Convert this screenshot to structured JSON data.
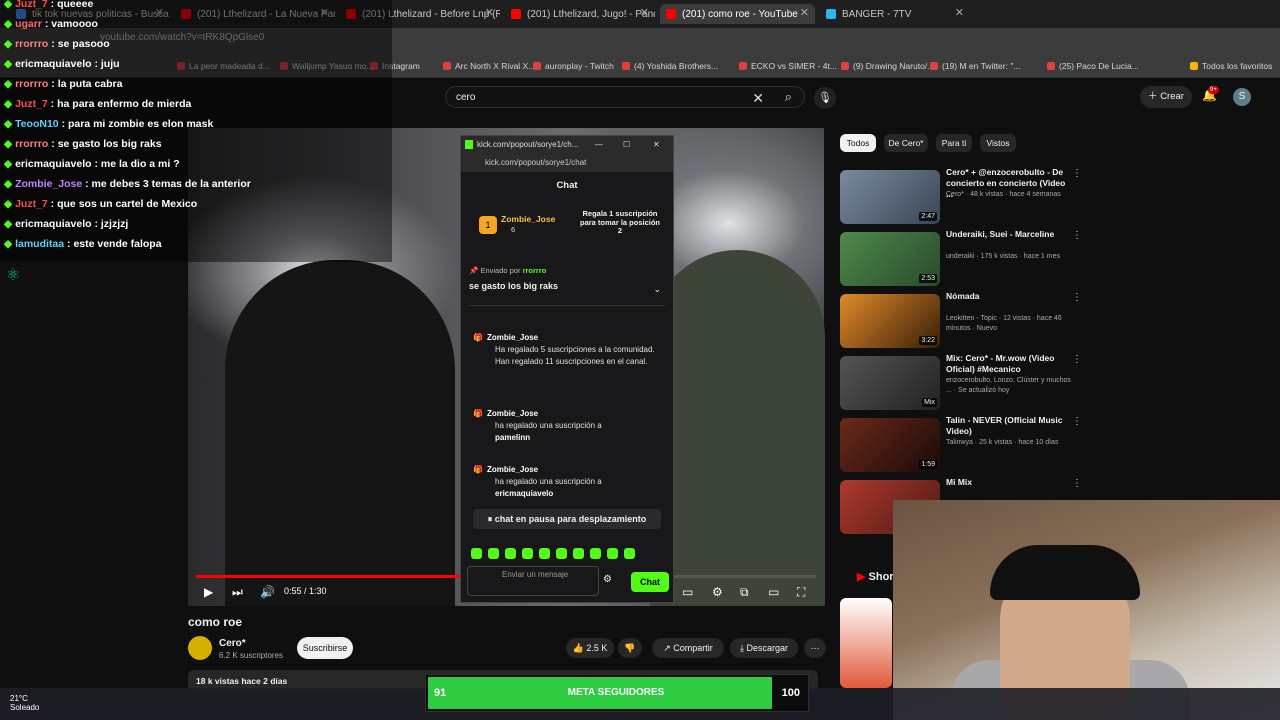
{
  "tabs": [
    {
      "label": "tik tok nuevas politicas - Busca",
      "color": "#4285f4"
    },
    {
      "label": "(201) Lthelizard - La Nueva Pan",
      "color": "#ff0000"
    },
    {
      "label": "(201) Lthelizard - Before Lnp (R",
      "color": "#ff0000"
    },
    {
      "label": "(201) Lthelizard, Jugo! - Pandem",
      "color": "#ff0000"
    },
    {
      "label": "(201) como roe - YouTube",
      "color": "#ff0000"
    },
    {
      "label": "BANGER - 7TV",
      "color": "#29b6f6"
    }
  ],
  "url": "youtube.com/watch?v=tRK8QpGlse0",
  "bookmarks": [
    "Arc North X Rival X...",
    "auronplay - Twitch",
    "(4) Yoshida Brothers...",
    "ECKO vs SIMER - 4t...",
    "(9) Drawing Naruto/...",
    "(19) M en Twitter: \"...",
    "(25) Paco De Lucia...",
    "Todos los favoritos",
    "Instagram",
    "La peor madeada d...",
    "Walljump Yasuo mo..."
  ],
  "yt": {
    "search_value": "cero",
    "create": "Crear",
    "notif_count": "9+",
    "avatar": "S"
  },
  "video": {
    "time": "0:55 / 1:30",
    "progress": 0.61,
    "title": "como roe",
    "channel": "Cero*",
    "subs": "6.2 K suscriptores",
    "subscribe": "Suscribirse",
    "likes": "2.5 K",
    "share": "Compartir",
    "download": "Descargar",
    "views": "18 k vistas  hace 2 días"
  },
  "chips": [
    "Todos",
    "De Cero*",
    "Para ti",
    "Vistos"
  ],
  "recs": [
    {
      "title": "Cero* + @enzocerobulto - De concierto en concierto (Video ...",
      "meta": "Cero*  ·  48 k vistas · hace 4 semanas",
      "dur": "2:47",
      "c1": "#7a8aa0",
      "c2": "#3b4654"
    },
    {
      "title": "Underaiki, Suei - Marceline",
      "meta": "underaiki  ·  175 k vistas · hace 1 mes",
      "dur": "2:53",
      "c1": "#4e8a4a",
      "c2": "#2a4a2d"
    },
    {
      "title": "Nómada",
      "meta": "Leokitten - Topic  ·  12 vistas · hace 46 minutos  ·  Nuevo",
      "dur": "3:22",
      "c1": "#e08a2a",
      "c2": "#3a1f0a"
    },
    {
      "title": "Mix: Cero* - Mr.wow (Video Oficial) #Mecanico",
      "meta": "enzocerobulto, Lonzo, Clúster y muchos ...  ·  Se actualizó hoy",
      "dur": "Mix",
      "c1": "#555",
      "c2": "#222"
    },
    {
      "title": "Talin - NEVER (Official Music Video)",
      "meta": "Talinwya  ·  25 k vistas · hace 10 días",
      "dur": "1:59",
      "c1": "#6b2a1a",
      "c2": "#1a0a08"
    },
    {
      "title": "Mi Mix",
      "meta": "",
      "dur": "",
      "c1": "#b03a2e",
      "c2": "#4a1a14"
    }
  ],
  "shorts_label": "Shorts",
  "overlay_chat": [
    {
      "user": "Juzt_7",
      "msg": "queeee",
      "color": "#ff4d4d"
    },
    {
      "user": "ugarr",
      "msg": "vamoooo",
      "color": "#ff6b6b"
    },
    {
      "user": "rrorrro",
      "msg": "se pasooo",
      "color": "#ff8080"
    },
    {
      "user": "ericmaquiavelo",
      "msg": "juju",
      "color": "#ffffff"
    },
    {
      "user": "rrorrro",
      "msg": "la puta cabra",
      "color": "#ff8080"
    },
    {
      "user": "Juzt_7",
      "msg": "ha para enfermo de mierda",
      "color": "#ff4d4d"
    },
    {
      "user": "TeooN10",
      "msg": "para mi zombie es elon mask",
      "color": "#5dd1ff"
    },
    {
      "user": "rrorrro",
      "msg": "se gasto los big raks",
      "color": "#ff8080"
    },
    {
      "user": "ericmaquiavelo",
      "msg": "me la dio a mi ?",
      "color": "#ffffff"
    },
    {
      "user": "Zombie_Jose",
      "msg": "me debes 3 temas de la anterior",
      "color": "#c084fc"
    },
    {
      "user": "Juzt_7",
      "msg": "que sos un cartel de Mexico",
      "color": "#ff4d4d"
    },
    {
      "user": "ericmaquiavelo",
      "msg": "jzjzjzj",
      "color": "#ffffff"
    },
    {
      "user": "lamuditaa",
      "msg": "este vende falopa",
      "color": "#5dd1ff"
    }
  ],
  "popup": {
    "window_title": "kick.com/popout/sorye1/ch...",
    "url": "kick.com/popout/sorye1/chat",
    "header": "Chat",
    "gifter_name": "Zombie_Jose",
    "gifter_count": "6",
    "gift_prompt": "Regala 1 suscripción para tomar la posición 2",
    "pinned_by": "Enviado por",
    "pinned_user": "rrorrro",
    "pinned_msg": "se gasto los big raks",
    "events": [
      {
        "user": "Zombie_Jose",
        "text": "Ha regalado 5 suscripciones a la comunidad. Han regalado 11 suscripciones en el canal.",
        "target": ""
      },
      {
        "user": "Zombie_Jose",
        "text": "ha regalado una suscripción a",
        "target": "pamelinn"
      },
      {
        "user": "Zombie_Jose",
        "text": "ha regalado una suscripción a",
        "target": "ericmaquiavelo"
      }
    ],
    "pause": "chat en pausa para desplazamiento",
    "input_placeholder": "Enviar un mensaje",
    "chat_button": "Chat"
  },
  "goal": {
    "left": "91",
    "label": "META SEGUIDORES",
    "right": "100",
    "progress": 0.91
  },
  "weather": {
    "temp": "21°C",
    "status": "Soleado"
  },
  "colors": {
    "kick": "#53fc18",
    "youtube_red": "#ff0000"
  }
}
